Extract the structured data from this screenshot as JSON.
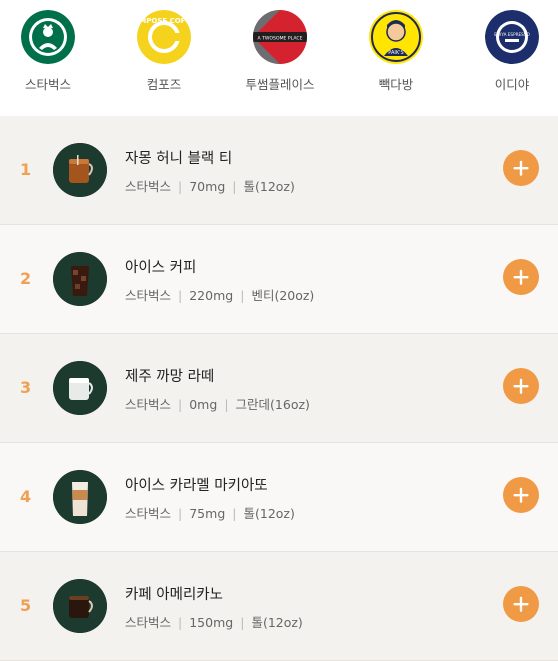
{
  "brands": [
    {
      "name": "스타벅스",
      "logo": "starbucks-logo"
    },
    {
      "name": "컴포즈",
      "logo": "compose-coffee-logo",
      "logo_text": "COMPOSE COFFEE"
    },
    {
      "name": "투썸플레이스",
      "logo": "twosome-place-logo",
      "logo_text": "A TWOSOME PLACE"
    },
    {
      "name": "빽다방",
      "logo": "paiks-coffee-logo",
      "logo_text": "PAIK'S"
    },
    {
      "name": "이디야",
      "logo": "ediya-coffee-logo",
      "logo_text": "EDIYA ESPRESSO"
    }
  ],
  "drinks": [
    {
      "rank": "1",
      "title": "자몽 허니 블랙 티",
      "brand": "스타벅스",
      "caffeine": "70mg",
      "size": "톨(12oz)"
    },
    {
      "rank": "2",
      "title": "아이스 커피",
      "brand": "스타벅스",
      "caffeine": "220mg",
      "size": "벤티(20oz)"
    },
    {
      "rank": "3",
      "title": "제주 까망 라떼",
      "brand": "스타벅스",
      "caffeine": "0mg",
      "size": "그란데(16oz)"
    },
    {
      "rank": "4",
      "title": "아이스 카라멜 마키아또",
      "brand": "스타벅스",
      "caffeine": "75mg",
      "size": "톨(12oz)"
    },
    {
      "rank": "5",
      "title": "카페 아메리카노",
      "brand": "스타벅스",
      "caffeine": "150mg",
      "size": "톨(12oz)"
    }
  ],
  "colors": {
    "accent": "#f09a46",
    "thumb_bg": "#1d3a2f",
    "starbucks_green": "#00704a",
    "compose_yellow": "#f5d21c",
    "twosome_red": "#d4222e",
    "paiks_yellow": "#ffe500",
    "ediya_navy": "#1c2e6b"
  },
  "icons": {
    "add_button": "plus-icon"
  }
}
